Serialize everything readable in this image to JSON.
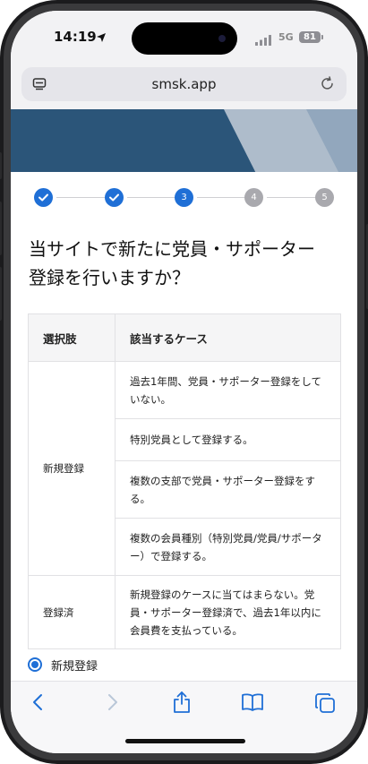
{
  "status_bar": {
    "time": "14:19",
    "network": "5G",
    "battery": "81",
    "icons": [
      "location-arrow-icon",
      "signal-icon",
      "battery-icon"
    ]
  },
  "browser": {
    "url": "smsk.app",
    "icons": [
      "tabs-icon",
      "reload-icon"
    ]
  },
  "stepper": {
    "steps": [
      {
        "label": "",
        "state": "done"
      },
      {
        "label": "",
        "state": "done"
      },
      {
        "label": "3",
        "state": "current"
      },
      {
        "label": "4",
        "state": "todo"
      },
      {
        "label": "5",
        "state": "todo"
      }
    ]
  },
  "question": {
    "line1": "当サイトで新たに党員・サポーター",
    "line2": "登録を行いますか？"
  },
  "table": {
    "headers": [
      "選択肢",
      "該当するケース"
    ],
    "rows": [
      {
        "option": "新規登録",
        "cases": [
          "過去1年間、党員・サポーター登録をしていない。",
          "特別党員として登録する。",
          "複数の支部で党員・サポーター登録をする。",
          "複数の会員種別（特別党員/党員/サポーター）で登録する。"
        ]
      },
      {
        "option": "登録済",
        "cases": [
          "新規登録のケースに当てはまらない。党員・サポーター登録済で、過去1年以内に会員費を支払っている。"
        ]
      }
    ]
  },
  "radio": {
    "label": "新規登録",
    "selected": true
  },
  "colors": {
    "accent": "#1f6fd6",
    "banner": "#2b5579",
    "inactive_step": "#a9a9ae"
  }
}
